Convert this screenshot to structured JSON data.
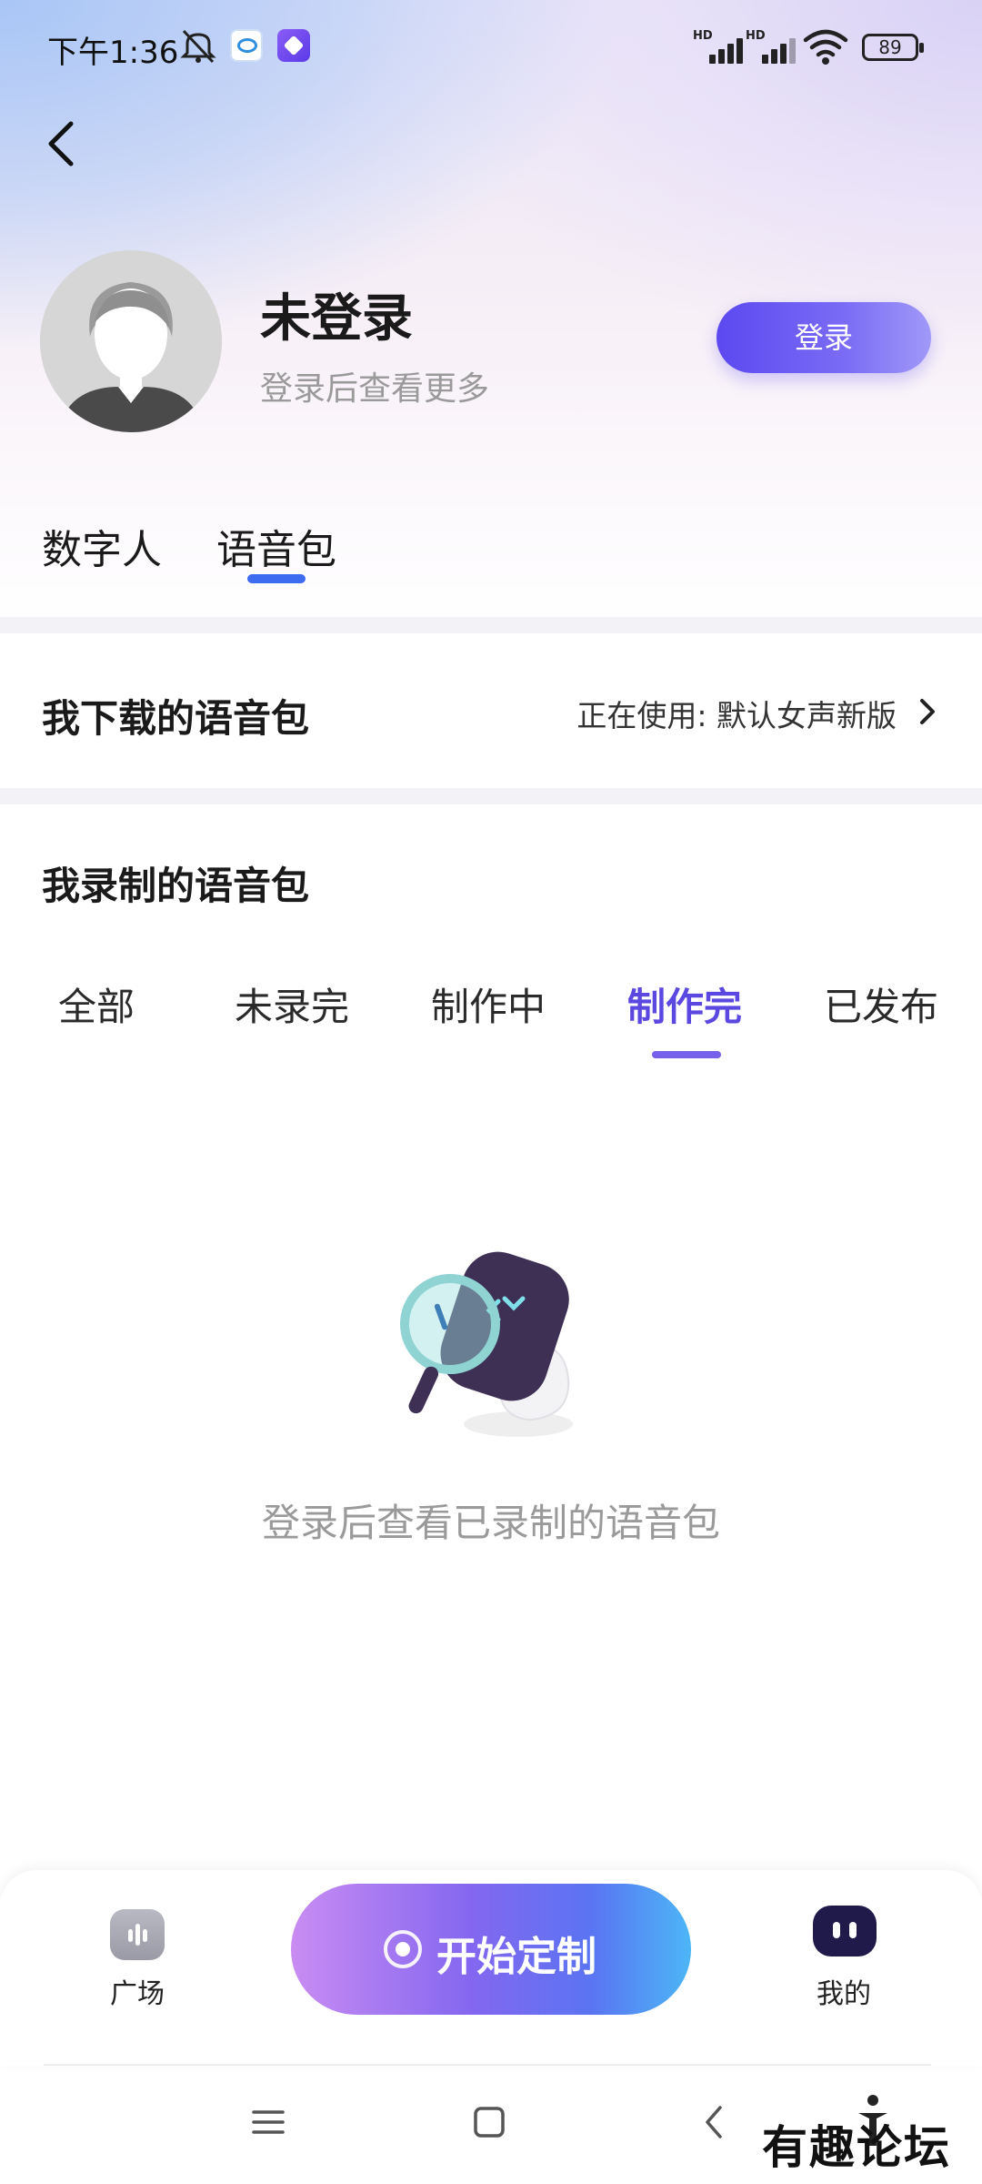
{
  "status_bar": {
    "time": "下午1:36",
    "battery": "89",
    "signal_label": "HD"
  },
  "header": {
    "back_icon": "chevron-left-icon"
  },
  "profile": {
    "name": "未登录",
    "subtitle": "登录后查看更多",
    "login_label": "登录"
  },
  "main_tabs": [
    {
      "label": "数字人",
      "active": false
    },
    {
      "label": "语音包",
      "active": true
    }
  ],
  "downloaded": {
    "title": "我下载的语音包",
    "using_label": "正在使用: 默认女声新版"
  },
  "recorded": {
    "title": "我录制的语音包",
    "tabs": [
      {
        "label": "全部",
        "active": false
      },
      {
        "label": "未录完",
        "active": false
      },
      {
        "label": "制作中",
        "active": false
      },
      {
        "label": "制作完",
        "active": true
      },
      {
        "label": "已发布",
        "active": false
      }
    ],
    "empty_text": "登录后查看已录制的语音包"
  },
  "bottom_nav": {
    "plaza_label": "广场",
    "start_label": "开始定制",
    "mine_label": "我的"
  },
  "watermark": "有趣论坛",
  "colors": {
    "accent": "#5a48e0",
    "tab_underline": "#3d6cf0",
    "login_button": "#5b49f0"
  }
}
